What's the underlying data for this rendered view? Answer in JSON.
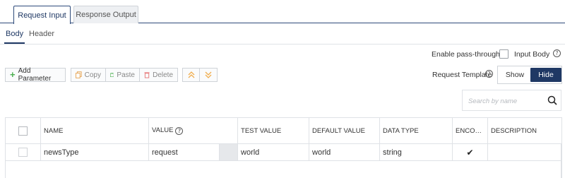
{
  "tabs": {
    "request_input": "Request Input",
    "response_output": "Response Output"
  },
  "subtabs": {
    "body": "Body",
    "header": "Header"
  },
  "pass_through": {
    "label": "Enable pass-through:",
    "checkbox_label": "Input Body",
    "checked": false
  },
  "toolbar": {
    "add_parameter": "Add Parameter",
    "copy": "Copy",
    "paste": "Paste",
    "delete": "Delete"
  },
  "request_template": {
    "label": "Request Template",
    "show": "Show",
    "hide": "Hide",
    "selected": "Hide"
  },
  "search": {
    "placeholder": "Search by name",
    "value": ""
  },
  "icons": {
    "help": "?",
    "plus": "+",
    "up": "︽",
    "down": "︾",
    "check": "✔"
  },
  "table": {
    "headers": {
      "name": "NAME",
      "value": "VALUE",
      "test_value": "TEST VALUE",
      "default_value": "DEFAULT VALUE",
      "data_type": "DATA TYPE",
      "encode": "ENCODE...",
      "description": "DESCRIPTION"
    },
    "rows": [
      {
        "name": "newsType",
        "value": "request",
        "test_value": "world",
        "default_value": "world",
        "data_type": "string",
        "encode": true,
        "description": ""
      }
    ]
  },
  "colors": {
    "primary": "#1f3864",
    "border": "#dfe2e6",
    "add_icon": "#4caf50",
    "arrow_icon": "#f0ad4e"
  }
}
